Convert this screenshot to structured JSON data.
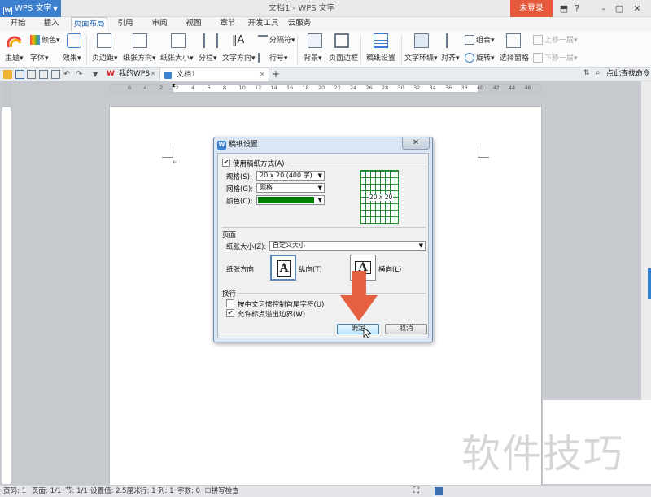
{
  "titlebar": {
    "app_menu": "WPS 文字",
    "title": "文档1 - WPS 文字",
    "login": "未登录",
    "controls": [
      "⬒",
      "?",
      "–",
      "▢",
      "✕"
    ]
  },
  "ribbon_tabs": [
    "开始",
    "插入",
    "页面布局",
    "引用",
    "审阅",
    "视图",
    "章节",
    "开发工具",
    "云服务"
  ],
  "ribbon": {
    "theme": "主题",
    "colors": "颜色",
    "fonts": "字体",
    "effects": "效果",
    "margins": "页边距",
    "orientation": "纸张方向",
    "size": "纸张大小",
    "columns": "分栏",
    "text_direction": "文字方向",
    "breaks": "分隔符",
    "line_numbers": "行号",
    "background": "背景",
    "page_border": "页面边框",
    "grid_paper": "稿纸设置",
    "wrap": "文字环绕",
    "align": "对齐",
    "group": "组合",
    "rotate": "旋转",
    "selection_pane": "选择窗格",
    "bring_forward": "上移一层",
    "send_backward": "下移一层"
  },
  "docbar": {
    "tabs": [
      {
        "label": "我的WPS"
      },
      {
        "label": "文档1"
      }
    ],
    "add": "+",
    "search": "点此查找命令"
  },
  "ruler_numbers": [
    "6",
    "4",
    "2",
    "2",
    "4",
    "6",
    "8",
    "10",
    "12",
    "14",
    "16",
    "18",
    "20",
    "22",
    "24",
    "26",
    "28",
    "30",
    "32",
    "34",
    "36",
    "38",
    "40",
    "42",
    "44",
    "46"
  ],
  "page": {
    "paragraph_mark": "↵"
  },
  "dialog": {
    "title": "稿纸设置",
    "close": "✕",
    "use_grid": "使用稿纸方式(A)",
    "spec_label": "规格(S):",
    "spec_value": "20 x 20 (400 字)",
    "grid_label": "网格(G):",
    "grid_value": "网格",
    "color_label": "颜色(C):",
    "color_value": "#008000",
    "preview_caption": "20 x 20",
    "page_section": "页面",
    "paper_size_label": "纸张大小(Z):",
    "paper_size_value": "自定义大小",
    "orientation_label": "纸张方向",
    "portrait": "纵向(T)",
    "landscape": "横向(L)",
    "wrap_section": "换行",
    "opt_punct_control": "按中文习惯控制首尾字符(U)",
    "opt_overflow": "允许标点溢出边界(W)",
    "opt_punct_checked": false,
    "opt_overflow_checked": true,
    "use_grid_checked": true,
    "ok": "确定",
    "cancel": "取消"
  },
  "statusbar": {
    "page_num": "页码: 1",
    "pages": "页面: 1/1",
    "section": "节: 1/1",
    "position": "设置值: 2.5厘米",
    "row": "行: 1",
    "col": "列: 1",
    "words": "字数: 0",
    "spell": "拼写检查"
  },
  "watermark": "软件技巧",
  "colors": {
    "accent": "#3d7fcf",
    "login": "#e55a3b",
    "arrow": "#e4603e",
    "grid": "#1f8a2e"
  }
}
